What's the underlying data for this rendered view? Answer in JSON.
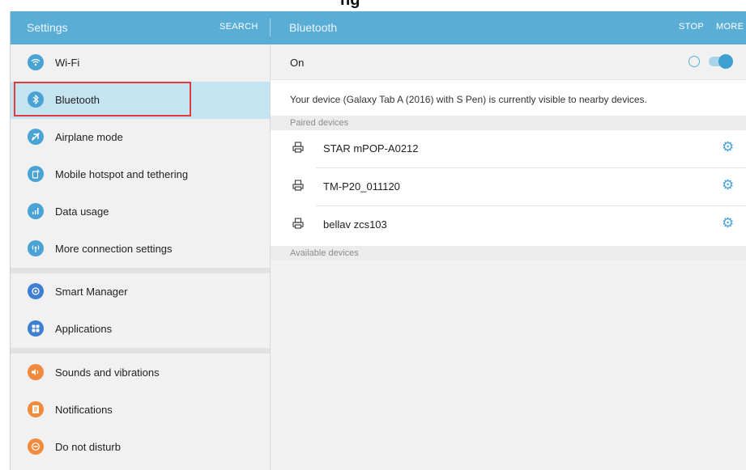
{
  "page_heading_cut": "ng",
  "appbar": {
    "left_title": "Settings",
    "search_label": "SEARCH",
    "right_title": "Bluetooth",
    "stop_label": "STOP",
    "more_label": "MORE"
  },
  "sidebar": {
    "items": [
      {
        "label": "Wi-Fi",
        "icon": "wifi-icon",
        "color": "#4aa3d5"
      },
      {
        "label": "Bluetooth",
        "icon": "bluetooth-icon",
        "color": "#4aa3d5"
      },
      {
        "label": "Airplane mode",
        "icon": "airplane-icon",
        "color": "#4aa3d5"
      },
      {
        "label": "Mobile hotspot and tethering",
        "icon": "hotspot-icon",
        "color": "#4aa3d5"
      },
      {
        "label": "Data usage",
        "icon": "data-usage-icon",
        "color": "#4aa3d5"
      },
      {
        "label": "More connection settings",
        "icon": "connection-settings-icon",
        "color": "#4aa3d5"
      },
      {
        "label": "Smart Manager",
        "icon": "smart-manager-icon",
        "color": "#3d7fd2"
      },
      {
        "label": "Applications",
        "icon": "applications-icon",
        "color": "#3d7fd2"
      },
      {
        "label": "Sounds and vibrations",
        "icon": "sound-icon",
        "color": "#f08a3c"
      },
      {
        "label": "Notifications",
        "icon": "notifications-icon",
        "color": "#f08a3c"
      },
      {
        "label": "Do not disturb",
        "icon": "do-not-disturb-icon",
        "color": "#f08a3c"
      }
    ],
    "selected": "Bluetooth"
  },
  "bluetooth": {
    "on_label": "On",
    "enabled": true,
    "visibility_text": "Your device (Galaxy Tab A (2016) with S Pen) is currently visible to nearby devices.",
    "paired_header": "Paired devices",
    "paired_devices": [
      {
        "name": "STAR mPOP-A0212",
        "icon": "printer-icon"
      },
      {
        "name": "TM-P20_011120",
        "icon": "printer-icon"
      },
      {
        "name": "bellav zcs103",
        "icon": "printer-icon"
      }
    ],
    "available_header": "Available devices"
  },
  "colors": {
    "appbar": "#5aaed6",
    "accent": "#4aa3d5",
    "selected_row": "#c5e4f2",
    "highlight_box": "#e23a3a"
  }
}
